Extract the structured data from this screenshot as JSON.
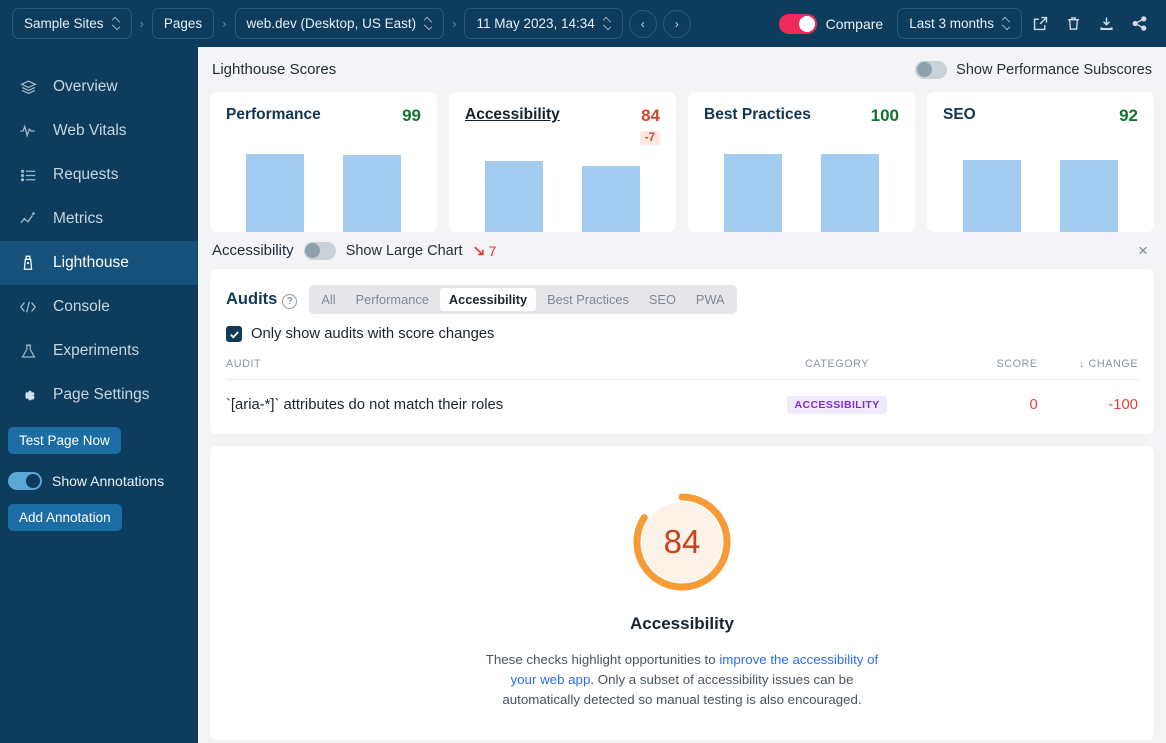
{
  "topbar": {
    "breadcrumbs": [
      {
        "label": "Sample Sites",
        "has_chevron": true
      },
      {
        "label": "Pages",
        "has_chevron": false
      },
      {
        "label": "web.dev (Desktop, US East)",
        "has_chevron": true
      },
      {
        "label": "11 May 2023, 14:34",
        "has_chevron": true
      }
    ],
    "prev_label": "‹",
    "next_label": "›",
    "compare_label": "Compare",
    "compare_on": true,
    "range_label": "Last 3 months",
    "icons": [
      "external-link-icon",
      "trash-icon",
      "download-icon",
      "share-icon"
    ]
  },
  "sidebar": {
    "items": [
      {
        "label": "Overview",
        "icon": "layers-icon",
        "active": false
      },
      {
        "label": "Web Vitals",
        "icon": "pulse-icon",
        "active": false
      },
      {
        "label": "Requests",
        "icon": "list-icon",
        "active": false
      },
      {
        "label": "Metrics",
        "icon": "scatter-icon",
        "active": false
      },
      {
        "label": "Lighthouse",
        "icon": "lighthouse-icon",
        "active": true
      },
      {
        "label": "Console",
        "icon": "code-icon",
        "active": false
      },
      {
        "label": "Experiments",
        "icon": "flask-icon",
        "active": false
      },
      {
        "label": "Page Settings",
        "icon": "gear-icon",
        "active": false
      }
    ],
    "test_page_label": "Test Page Now",
    "show_annotations_label": "Show Annotations",
    "show_annotations_on": true,
    "add_annotation_label": "Add Annotation"
  },
  "scores_section": {
    "title": "Lighthouse Scores",
    "subscores_label": "Show Performance Subscores",
    "subscores_on": false,
    "cards": [
      {
        "name": "Performance",
        "score": "99",
        "score_color": "#137333",
        "delta": "",
        "selected": false,
        "bars": [
          100,
          99
        ]
      },
      {
        "name": "Accessibility",
        "score": "84",
        "score_color": "#d1462a",
        "delta": "-7",
        "selected": true,
        "bars": [
          91,
          84
        ]
      },
      {
        "name": "Best Practices",
        "score": "100",
        "score_color": "#137333",
        "delta": "",
        "selected": false,
        "bars": [
          100,
          100
        ]
      },
      {
        "name": "SEO",
        "score": "92",
        "score_color": "#137333",
        "delta": "",
        "selected": false,
        "bars": [
          92,
          92
        ]
      }
    ]
  },
  "detail_header": {
    "title": "Accessibility",
    "large_chart_label": "Show Large Chart",
    "large_chart_on": false,
    "trend_value": "7",
    "trend_direction": "down",
    "close_label": "×"
  },
  "audits": {
    "title": "Audits",
    "help_label": "?",
    "filters": [
      {
        "label": "All",
        "active": false
      },
      {
        "label": "Performance",
        "active": false
      },
      {
        "label": "Accessibility",
        "active": true
      },
      {
        "label": "Best Practices",
        "active": false
      },
      {
        "label": "SEO",
        "active": false
      },
      {
        "label": "PWA",
        "active": false
      }
    ],
    "checkbox_label": "Only show audits with score changes",
    "checkbox_checked": true,
    "columns": [
      "AUDIT",
      "CATEGORY",
      "SCORE",
      "↓ CHANGE"
    ],
    "rows": [
      {
        "audit": "`[aria-*]` attributes do not match their roles",
        "category": "ACCESSIBILITY",
        "score": "0",
        "change": "-100"
      }
    ]
  },
  "gauge": {
    "value": "84",
    "percent": 84,
    "label": "Accessibility",
    "arc_color": "#f89a35",
    "fill_color": "#fdf2e8",
    "text_before_link": "These checks highlight opportunities to ",
    "link_text": "improve the accessibility of your web app",
    "text_after_link": ". Only a subset of accessibility issues can be automatically detected so manual testing is also encouraged."
  }
}
